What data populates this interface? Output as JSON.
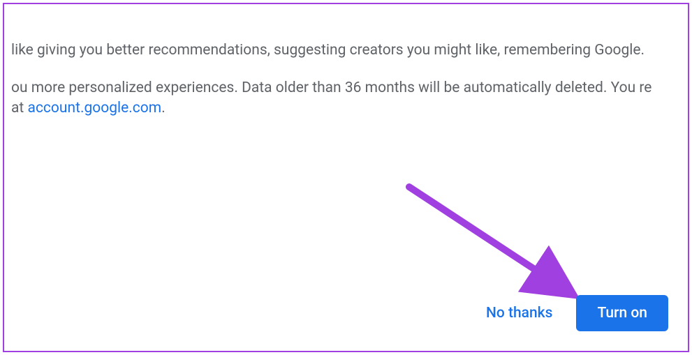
{
  "dialog": {
    "paragraph1": "like giving you better recommendations, suggesting creators you might like, remembering Google.",
    "paragraph2_a": "ou more personalized experiences. Data older than 36 months will be automatically deleted. You re at ",
    "link_text": "account.google.com",
    "paragraph2_b": "."
  },
  "actions": {
    "no_thanks": "No thanks",
    "turn_on": "Turn on"
  },
  "annotation": {
    "arrow_color": "#a040e0"
  }
}
